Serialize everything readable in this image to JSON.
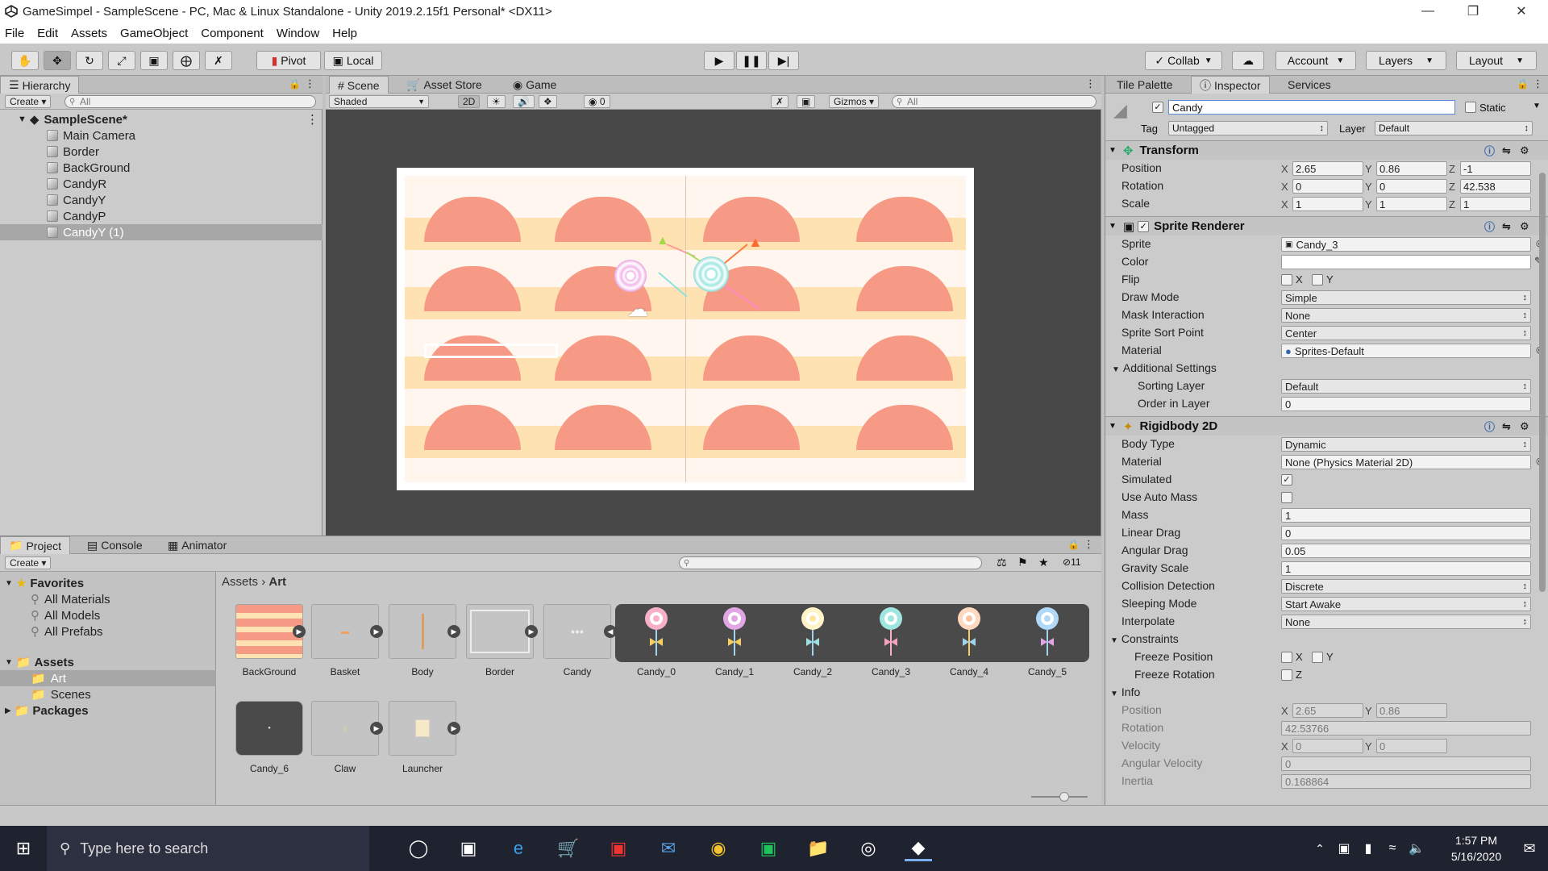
{
  "window": {
    "title": "GameSimpel - SampleScene - PC, Mac & Linux Standalone - Unity 2019.2.15f1 Personal* <DX11>"
  },
  "menu": [
    "File",
    "Edit",
    "Assets",
    "GameObject",
    "Component",
    "Window",
    "Help"
  ],
  "toolbar": {
    "pivot": "Pivot",
    "local": "Local",
    "collab": "Collab",
    "account": "Account",
    "layers": "Layers",
    "layout": "Layout"
  },
  "hierarchy": {
    "tab": "Hierarchy",
    "create": "Create",
    "search": "All",
    "scene": "SampleScene*",
    "items": [
      "Main Camera",
      "Border",
      "BackGround",
      "CandyR",
      "CandyY",
      "CandyP",
      "CandyY (1)"
    ]
  },
  "scene": {
    "tabs": [
      "Scene",
      "Asset Store",
      "Game"
    ],
    "shading": "Shaded",
    "mode2d": "2D",
    "gizmos": "Gizmos",
    "search": "All",
    "hidden_count": "0"
  },
  "project": {
    "tabs": [
      "Project",
      "Console",
      "Animator"
    ],
    "create": "Create",
    "breadcrumb": [
      "Assets",
      "Art"
    ],
    "count": "11",
    "tree": {
      "favorites": "Favorites",
      "fav_items": [
        "All Materials",
        "All Models",
        "All Prefabs"
      ],
      "assets": "Assets",
      "asset_items": [
        "Art",
        "Scenes"
      ],
      "packages": "Packages"
    },
    "assets": [
      "BackGround",
      "Basket",
      "Body",
      "Border",
      "Candy",
      "Candy_0",
      "Candy_1",
      "Candy_2",
      "Candy_3",
      "Candy_4",
      "Candy_5",
      "Candy_6",
      "Claw",
      "Launcher"
    ]
  },
  "inspector": {
    "tabs": [
      "Tile Palette",
      "Inspector",
      "Services"
    ],
    "name": "Candy",
    "static": "Static",
    "tag_label": "Tag",
    "tag": "Untagged",
    "layer_label": "Layer",
    "layer": "Default",
    "transform": {
      "title": "Transform",
      "position": {
        "label": "Position",
        "x": "2.65",
        "y": "0.86",
        "z": "-1"
      },
      "rotation": {
        "label": "Rotation",
        "x": "0",
        "y": "0",
        "z": "42.538"
      },
      "scale": {
        "label": "Scale",
        "x": "1",
        "y": "1",
        "z": "1"
      }
    },
    "sprite_renderer": {
      "title": "Sprite Renderer",
      "sprite_label": "Sprite",
      "sprite": "Candy_3",
      "color_label": "Color",
      "flip_label": "Flip",
      "flip_x": "X",
      "flip_y": "Y",
      "draw_mode_label": "Draw Mode",
      "draw_mode": "Simple",
      "mask_label": "Mask Interaction",
      "mask": "None",
      "sort_point_label": "Sprite Sort Point",
      "sort_point": "Center",
      "material_label": "Material",
      "material": "Sprites-Default",
      "additional": "Additional Settings",
      "sorting_layer_label": "Sorting Layer",
      "sorting_layer": "Default",
      "order_label": "Order in Layer",
      "order": "0"
    },
    "rigidbody": {
      "title": "Rigidbody 2D",
      "body_type_label": "Body Type",
      "body_type": "Dynamic",
      "material_label": "Material",
      "material": "None (Physics Material 2D)",
      "simulated_label": "Simulated",
      "simulated": true,
      "auto_mass_label": "Use Auto Mass",
      "auto_mass": false,
      "mass_label": "Mass",
      "mass": "1",
      "linear_drag_label": "Linear Drag",
      "linear_drag": "0",
      "angular_drag_label": "Angular Drag",
      "angular_drag": "0.05",
      "gravity_label": "Gravity Scale",
      "gravity": "1",
      "collision_label": "Collision Detection",
      "collision": "Discrete",
      "sleep_label": "Sleeping Mode",
      "sleep": "Start Awake",
      "interp_label": "Interpolate",
      "interp": "None",
      "constraints": "Constraints",
      "freeze_pos_label": "Freeze Position",
      "freeze_rot_label": "Freeze Rotation",
      "fx": "X",
      "fy": "Y",
      "fz": "Z"
    },
    "info": {
      "title": "Info",
      "position_label": "Position",
      "px": "2.65",
      "py": "0.86",
      "rotation_label": "Rotation",
      "rotation": "42.53766",
      "velocity_label": "Velocity",
      "vx": "0",
      "vy": "0",
      "ang_vel_label": "Angular Velocity",
      "ang_vel": "0",
      "inertia_label": "Inertia",
      "inertia": "0.168864"
    }
  },
  "taskbar": {
    "search": "Type here to search",
    "time": "1:57 PM",
    "date": "5/16/2020"
  }
}
